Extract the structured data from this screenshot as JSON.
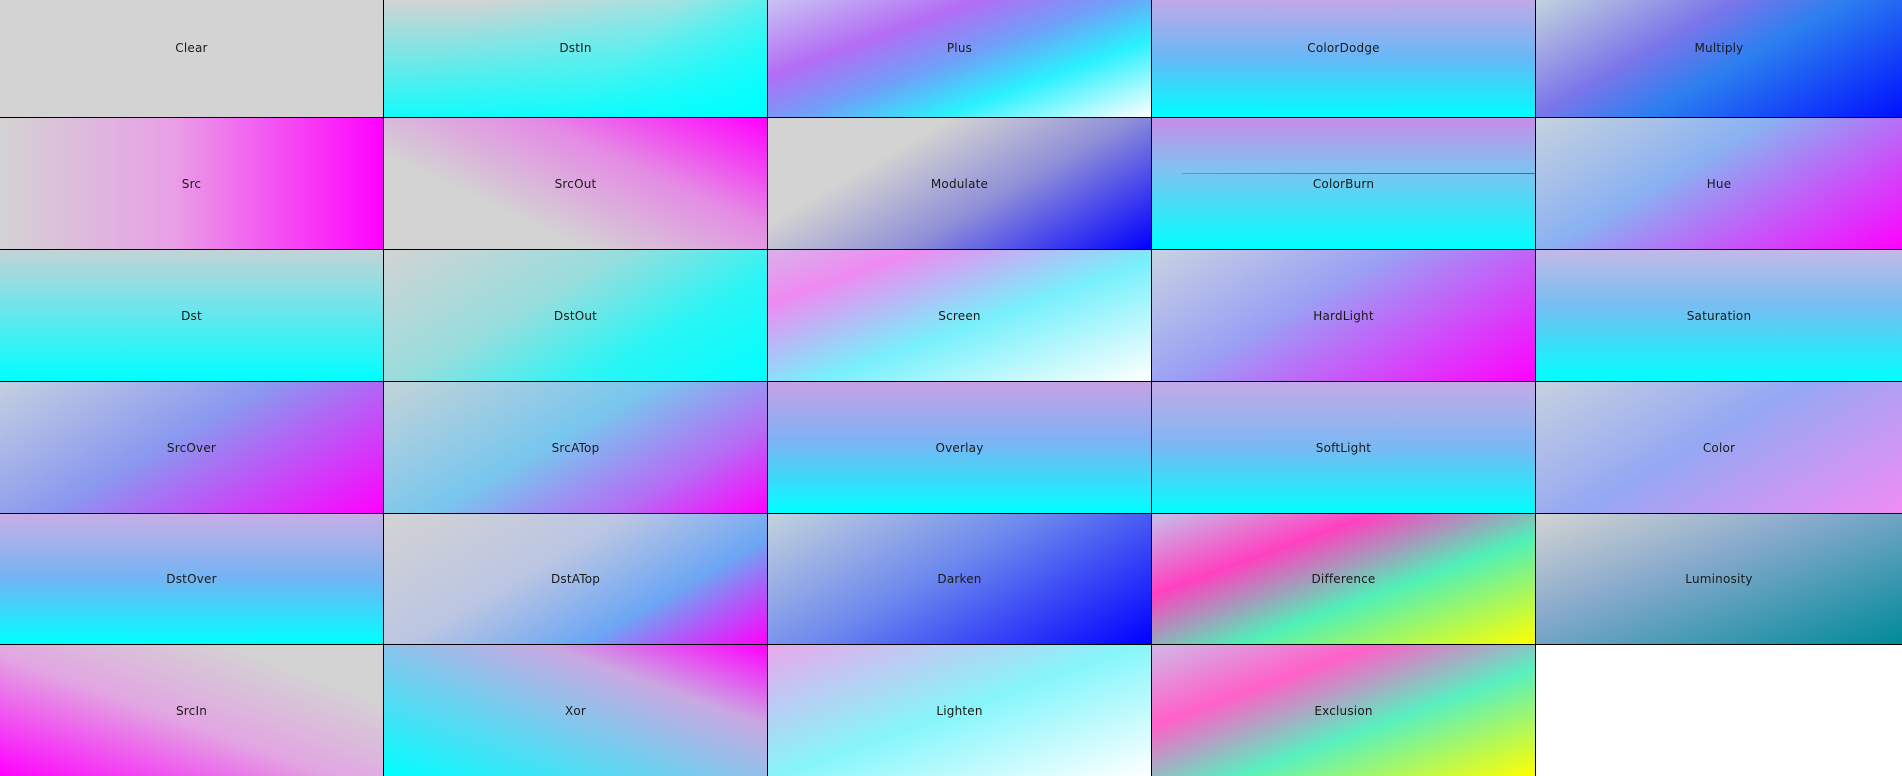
{
  "cells": [
    {
      "label": "Clear"
    },
    {
      "label": "DstIn"
    },
    {
      "label": "Plus"
    },
    {
      "label": "ColorDodge"
    },
    {
      "label": "Multiply"
    },
    {
      "label": "Src"
    },
    {
      "label": "SrcOut"
    },
    {
      "label": "Modulate"
    },
    {
      "label": "ColorBurn"
    },
    {
      "label": "Hue"
    },
    {
      "label": "Dst"
    },
    {
      "label": "DstOut"
    },
    {
      "label": "Screen"
    },
    {
      "label": "HardLight"
    },
    {
      "label": "Saturation"
    },
    {
      "label": "SrcOver"
    },
    {
      "label": "SrcATop"
    },
    {
      "label": "Overlay"
    },
    {
      "label": "SoftLight"
    },
    {
      "label": "Color"
    },
    {
      "label": "DstOver"
    },
    {
      "label": "DstATop"
    },
    {
      "label": "Darken"
    },
    {
      "label": "Difference"
    },
    {
      "label": "Luminosity"
    },
    {
      "label": "SrcIn"
    },
    {
      "label": "Xor"
    },
    {
      "label": "Lighten"
    },
    {
      "label": "Exclusion"
    }
  ],
  "colors": {
    "source": "#ff00ff",
    "destination": "#00ffff",
    "background": "#d3d3d3",
    "border": "#000000"
  }
}
